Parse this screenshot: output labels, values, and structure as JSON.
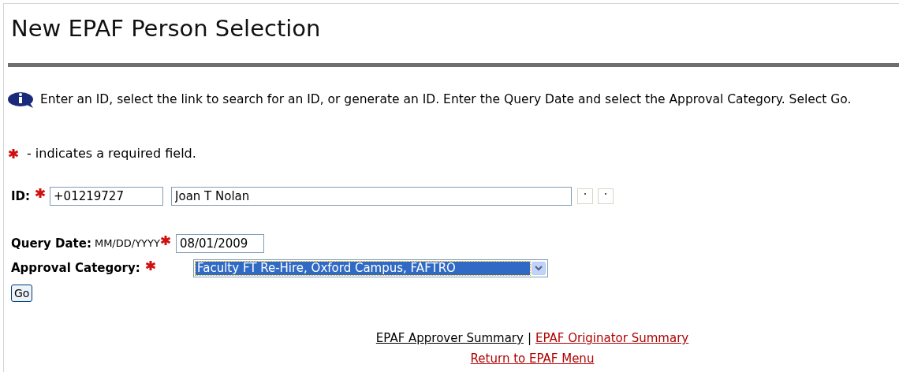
{
  "title": "New EPAF Person Selection",
  "info": "Enter an ID, select the link to search for an ID, or generate an ID. Enter the Query Date and select the Approval Category. Select Go.",
  "required_note": "- indicates a required field.",
  "id_row": {
    "label": "ID:",
    "id_value": "+01219727",
    "name_value": "Joan T Nolan"
  },
  "query_date": {
    "label": "Query Date:",
    "format": "MM/DD/YYYY",
    "value": "08/01/2009"
  },
  "approval_category": {
    "label": "Approval Category:",
    "value": "Faculty FT Re-Hire, Oxford Campus, FAFTRO"
  },
  "go_button": "Go",
  "link_separator": "|",
  "link_rows": [
    [
      {
        "label": "EPAF Approver Summary",
        "color": "#000000"
      },
      {
        "label": "EPAF Originator Summary",
        "color": "#b00000"
      }
    ],
    [
      {
        "label": "Return to EPAF Menu",
        "color": "#b00000"
      }
    ]
  ]
}
